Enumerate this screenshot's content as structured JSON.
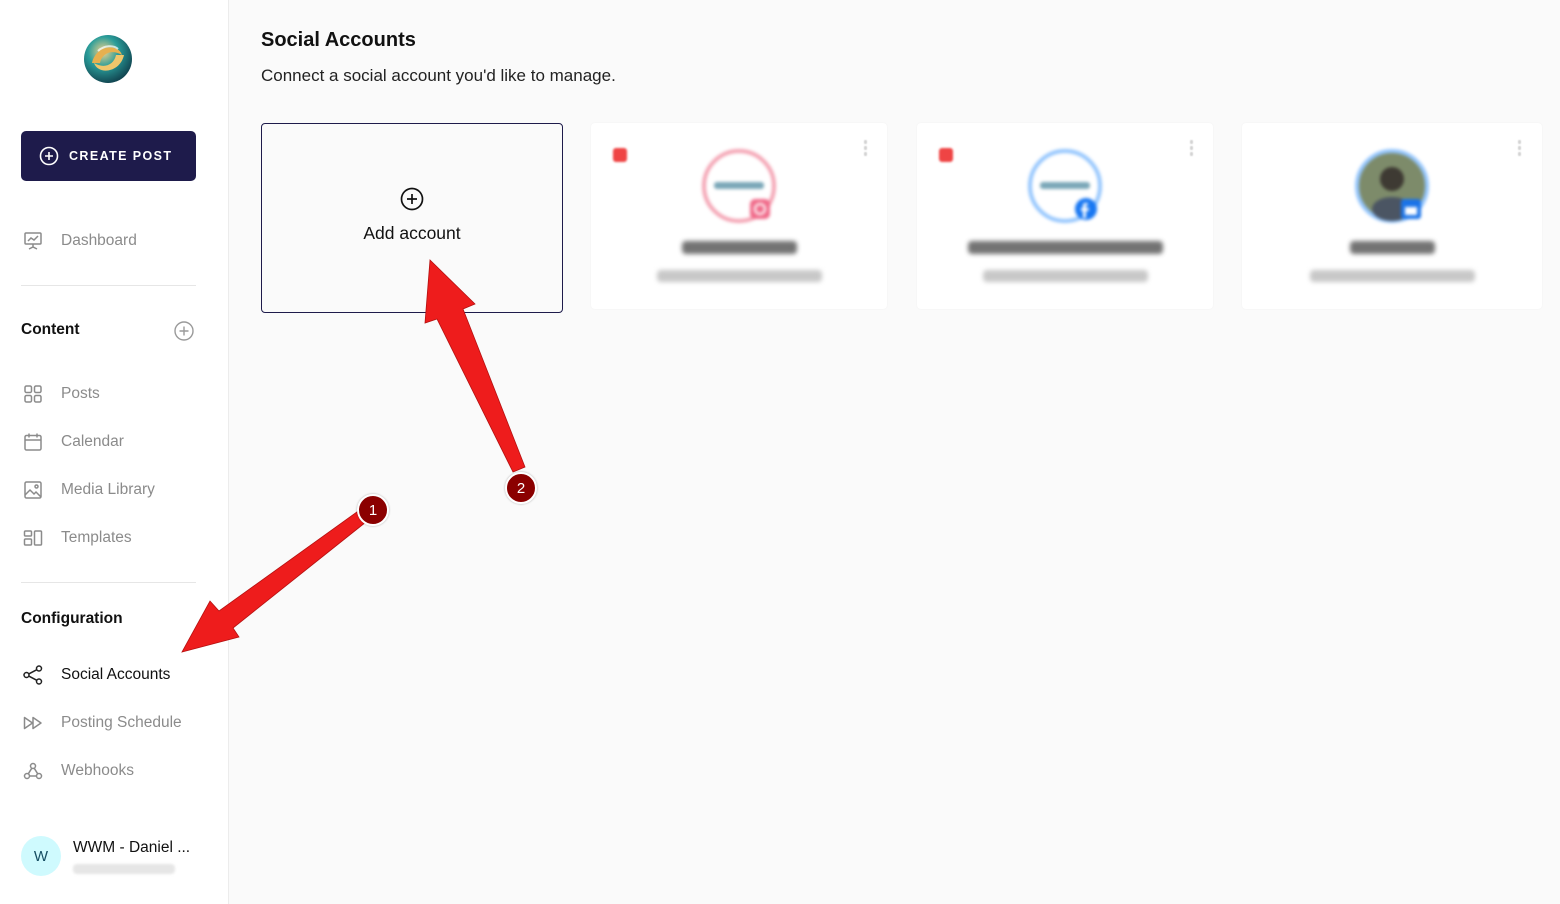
{
  "sidebar": {
    "create_label": "CREATE POST",
    "dashboard_label": "Dashboard",
    "content_title": "Content",
    "content_items": [
      "Posts",
      "Calendar",
      "Media Library",
      "Templates"
    ],
    "configuration_title": "Configuration",
    "configuration_items": [
      "Social Accounts",
      "Posting Schedule",
      "Webhooks"
    ],
    "active_item": "Social Accounts",
    "user": {
      "initial": "W",
      "name": "WWM - Daniel ..."
    }
  },
  "main": {
    "title": "Social Accounts",
    "subtitle": "Connect a social account you'd like to manage.",
    "add_card_label": "Add account",
    "accounts": [
      {
        "platform": "instagram",
        "status_color": "#ef4444"
      },
      {
        "platform": "facebook",
        "status_color": "#ef4444"
      },
      {
        "platform": "google-business"
      }
    ]
  },
  "annotations": {
    "badges": [
      "1",
      "2"
    ],
    "arrow_color": "#ff0000",
    "badge_color": "#8b0000"
  },
  "colors": {
    "brand": "#1e1b4b",
    "active_text": "#111111",
    "muted_text": "#8b8b8b"
  }
}
